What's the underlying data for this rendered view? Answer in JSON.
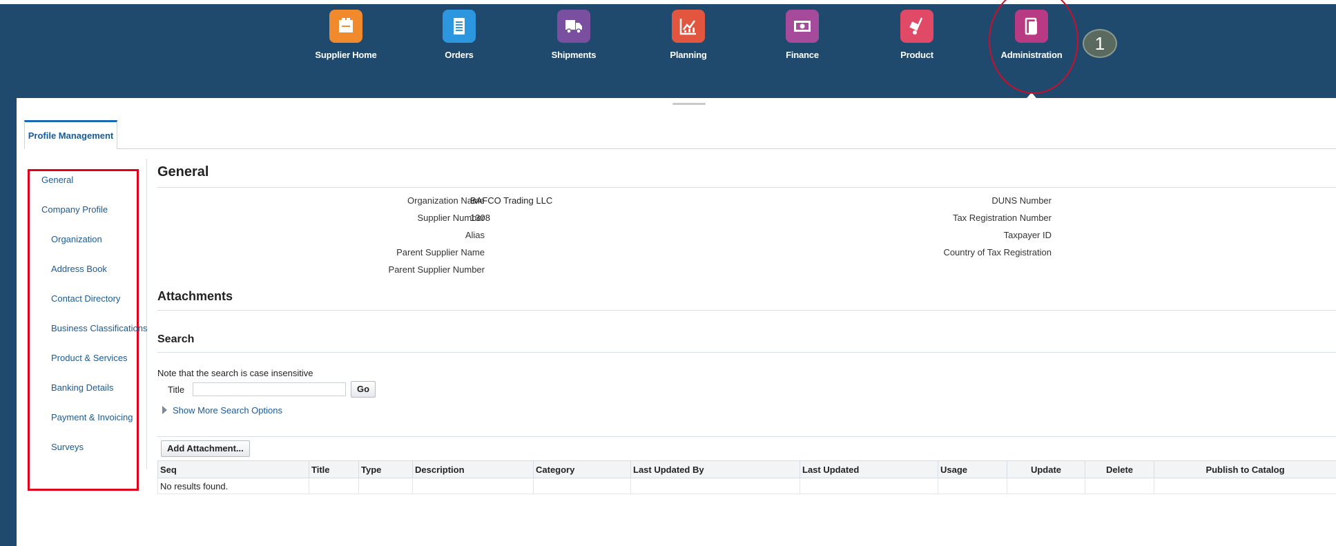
{
  "nav": {
    "items": [
      {
        "label": "Supplier Home",
        "icon": "supplier-home-icon",
        "color": "#f08a2c"
      },
      {
        "label": "Orders",
        "icon": "orders-icon",
        "color": "#2c97de"
      },
      {
        "label": "Shipments",
        "icon": "shipments-icon",
        "color": "#7b4fa0"
      },
      {
        "label": "Planning",
        "icon": "planning-icon",
        "color": "#e2553f"
      },
      {
        "label": "Finance",
        "icon": "finance-icon",
        "color": "#a64a9c"
      },
      {
        "label": "Product",
        "icon": "product-icon",
        "color": "#e04a67"
      },
      {
        "label": "Administration",
        "icon": "administration-icon",
        "color": "#b83a83"
      }
    ],
    "badge": "1",
    "bar_color": "#1f4a6e"
  },
  "tabs": [
    {
      "label": "Profile Management"
    }
  ],
  "sidebar": {
    "items": [
      {
        "label": "General"
      },
      {
        "label": "Company Profile"
      },
      {
        "label": "Organization"
      },
      {
        "label": "Address Book"
      },
      {
        "label": "Contact Directory"
      },
      {
        "label": "Business Classifications"
      },
      {
        "label": "Product & Services"
      },
      {
        "label": "Banking Details"
      },
      {
        "label": "Payment & Invoicing"
      },
      {
        "label": "Surveys"
      }
    ]
  },
  "general": {
    "title": "General",
    "left_fields": [
      {
        "label": "Organization Name",
        "value": "BAFCO Trading LLC"
      },
      {
        "label": "Supplier Number",
        "value": "1308"
      },
      {
        "label": "Alias",
        "value": ""
      },
      {
        "label": "Parent Supplier Name",
        "value": ""
      },
      {
        "label": "Parent Supplier Number",
        "value": ""
      }
    ],
    "right_fields": [
      {
        "label": "DUNS Number",
        "value": ""
      },
      {
        "label": "Tax Registration Number",
        "value": ""
      },
      {
        "label": "Taxpayer ID",
        "value": ""
      },
      {
        "label": "Country of Tax Registration",
        "value": ""
      }
    ]
  },
  "attachments": {
    "title": "Attachments",
    "search": {
      "title": "Search",
      "note": "Note that the search is case insensitive",
      "field_label": "Title",
      "field_value": "",
      "go_label": "Go",
      "more_options": "Show More Search Options"
    },
    "add_button": "Add Attachment...",
    "table": {
      "columns": [
        "Seq",
        "Title",
        "Type",
        "Description",
        "Category",
        "Last Updated By",
        "Last Updated",
        "Usage",
        "Update",
        "Delete",
        "Publish to Catalog"
      ],
      "empty_text": "No results found."
    }
  }
}
